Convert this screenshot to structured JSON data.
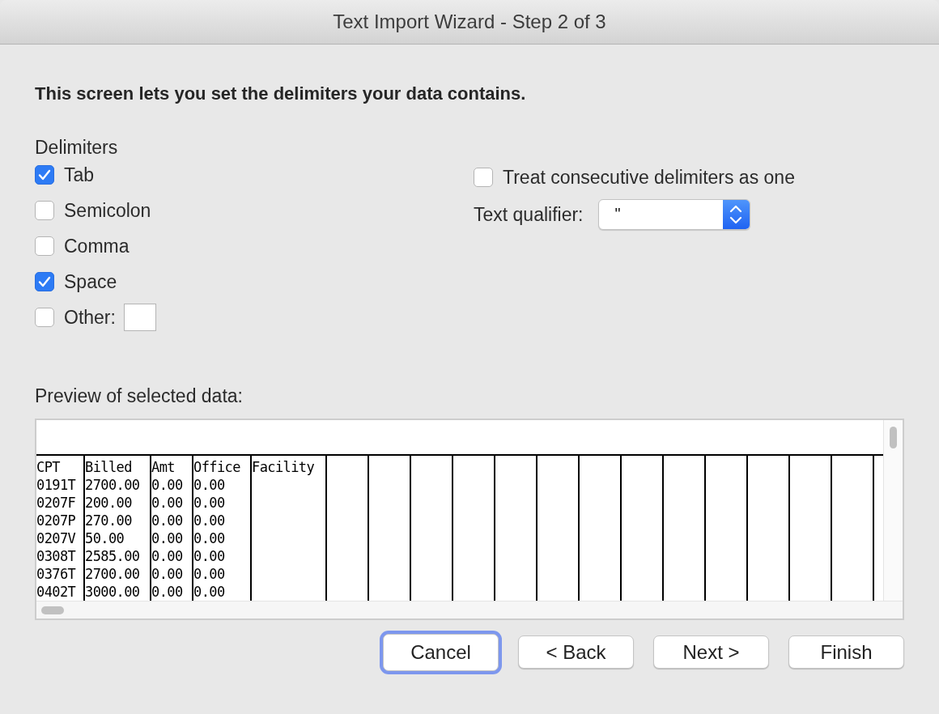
{
  "window": {
    "title": "Text Import Wizard - Step 2 of 3"
  },
  "heading": "This screen lets you set the delimiters your data contains.",
  "delimiters": {
    "label": "Delimiters",
    "options": [
      {
        "label": "Tab",
        "checked": true,
        "kind": "plain"
      },
      {
        "label": "Semicolon",
        "checked": false,
        "kind": "plain"
      },
      {
        "label": "Comma",
        "checked": false,
        "kind": "plain"
      },
      {
        "label": "Space",
        "checked": true,
        "kind": "plain"
      },
      {
        "label": "Other:",
        "checked": false,
        "kind": "field"
      }
    ]
  },
  "treat_consecutive": {
    "label": "Treat consecutive delimiters as one",
    "checked": false
  },
  "text_qualifier": {
    "label": "Text qualifier:",
    "value": "\""
  },
  "preview": {
    "label": "Preview of selected data:",
    "columns": [
      "CPT",
      "Billed",
      "Amt",
      "Office",
      "Facility"
    ],
    "rows": [
      [
        "0191T",
        "2700.00",
        "0.00",
        "0.00"
      ],
      [
        "0207F",
        "200.00",
        "0.00",
        "0.00"
      ],
      [
        "0207P",
        "270.00",
        "0.00",
        "0.00"
      ],
      [
        "0207V",
        "50.00",
        "0.00",
        "0.00"
      ],
      [
        "0308T",
        "2585.00",
        "0.00",
        "0.00"
      ],
      [
        "0376T",
        "2700.00",
        "0.00",
        "0.00"
      ],
      [
        "0402T",
        "3000.00",
        "0.00",
        "0.00"
      ]
    ]
  },
  "buttons": [
    {
      "label": "Cancel",
      "focused": true
    },
    {
      "label": "< Back",
      "focused": false
    },
    {
      "label": "Next >",
      "focused": false
    },
    {
      "label": "Finish",
      "focused": false
    }
  ]
}
